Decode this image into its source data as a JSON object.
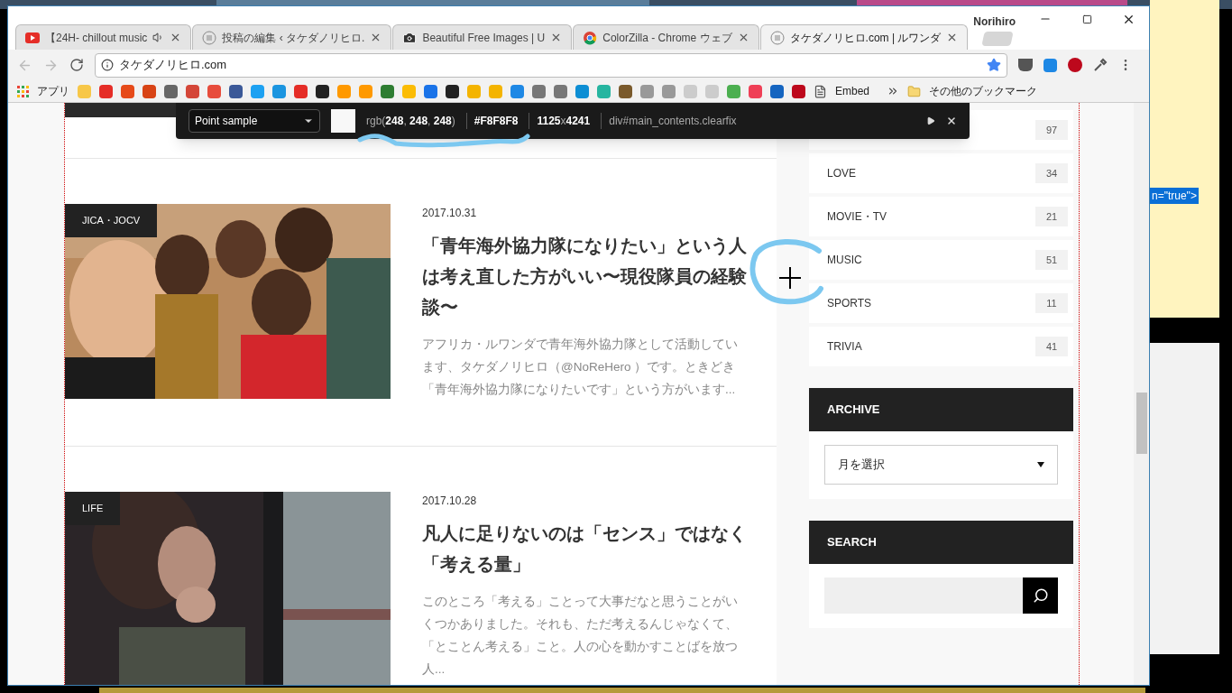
{
  "browser": {
    "profile": "Norihiro",
    "tabs": [
      {
        "title": "【24H- chillout music",
        "audio": true,
        "selected": false
      },
      {
        "title": "投稿の編集 ‹ タケダノリヒロ.",
        "audio": false,
        "selected": false
      },
      {
        "title": "Beautiful Free Images | U",
        "audio": false,
        "selected": false
      },
      {
        "title": "ColorZilla - Chrome ウェブ",
        "audio": false,
        "selected": false
      },
      {
        "title": "タケダノリヒロ.com | ルワンダ",
        "audio": false,
        "selected": true
      }
    ],
    "address": "タケダノリヒロ.com",
    "bookmarks": {
      "apps": "アプリ",
      "embed": "Embed",
      "other": "その他のブックマーク"
    }
  },
  "colorzilla": {
    "mode": "Point sample",
    "rgb": "rgb(**248**, **248**, **248**)",
    "hex": "#F8F8F8",
    "size": "**1125**x**4241**",
    "element": "div#main_contents.clearfix"
  },
  "posts": [
    {
      "category": "JICA・JOCV",
      "date": "2017.10.31",
      "title": "「青年海外協力隊になりたい」という人は考え直した方がいい〜現役隊員の経験談〜",
      "excerpt": "アフリカ・ルワンダで青年海外協力隊として活動しています、タケダノリヒロ（@NoReHero ）です。ときどき「青年海外協力隊になりたいです」という方がいます...",
      "kind": "picture"
    },
    {
      "category": "LIFE",
      "date": "2017.10.28",
      "title": "凡人に足りないのは「センス」ではなく「考える量」",
      "excerpt": "このところ「考える」ことって大事だなと思うことがいくつかありました。それも、ただ考えるんじゃなくて、「とことん考える」こと。人の心を動かすことばを放つ人...",
      "kind": "picture"
    }
  ],
  "sidebar": {
    "categories": [
      {
        "count": "97"
      },
      {
        "name": "LOVE",
        "count": "34"
      },
      {
        "name": "MOVIE・TV",
        "count": "21"
      },
      {
        "name": "MUSIC",
        "count": "51"
      },
      {
        "name": "SPORTS",
        "count": "11"
      },
      {
        "name": "TRIVIA",
        "count": "41"
      }
    ],
    "archive": {
      "title": "ARCHIVE",
      "select": "月を選択"
    },
    "search": {
      "title": "SEARCH"
    }
  },
  "desktop": {
    "code_snippet": "n=\"true\">"
  }
}
